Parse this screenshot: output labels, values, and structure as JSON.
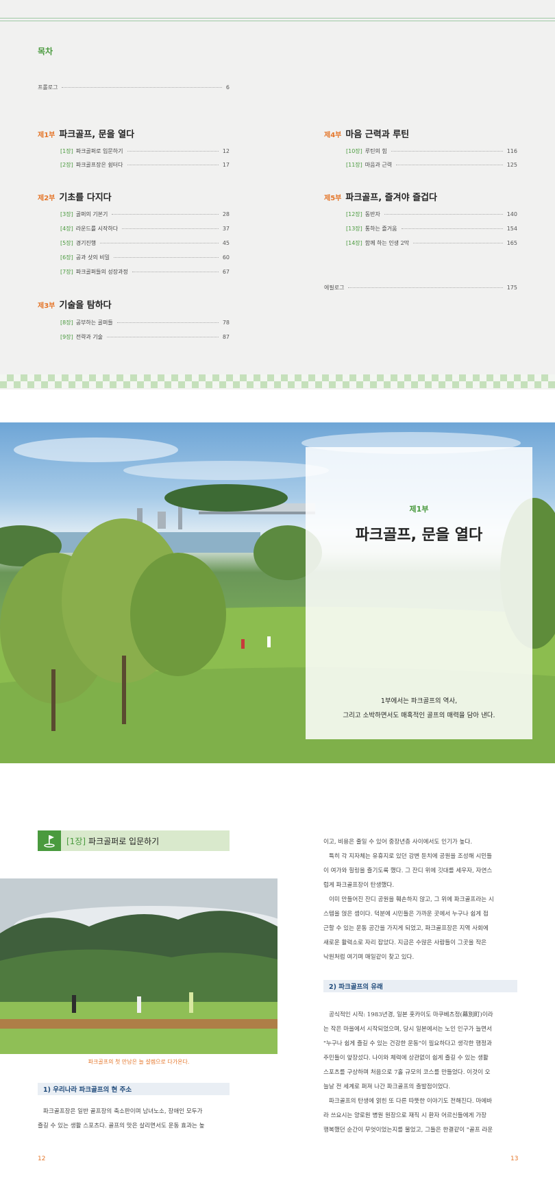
{
  "toc": {
    "heading": "목차",
    "prologue": {
      "label": "프롤로그",
      "page": "6"
    },
    "epilogue": {
      "label": "에필로그",
      "page": "175"
    },
    "parts": [
      {
        "num": "제1부",
        "title": "파크골프, 문을 열다",
        "chapters": [
          {
            "tag": "[1장]",
            "title": "파크골퍼로 입문하기",
            "page": "12"
          },
          {
            "tag": "[2장]",
            "title": "파크골프장은 쉼터다",
            "page": "17"
          }
        ]
      },
      {
        "num": "제2부",
        "title": "기초를 다지다",
        "chapters": [
          {
            "tag": "[3장]",
            "title": "골퍼의 기본기",
            "page": "28"
          },
          {
            "tag": "[4장]",
            "title": "라운드를 시작하다",
            "page": "37"
          },
          {
            "tag": "[5장]",
            "title": "경기진행",
            "page": "45"
          },
          {
            "tag": "[6장]",
            "title": "공과 샷의 비밀",
            "page": "60"
          },
          {
            "tag": "[7장]",
            "title": "파크골퍼들의 성장과정",
            "page": "67"
          }
        ]
      },
      {
        "num": "제3부",
        "title": "기술을 탐하다",
        "chapters": [
          {
            "tag": "[8장]",
            "title": "공부하는 골퍼들",
            "page": "78"
          },
          {
            "tag": "[9장]",
            "title": "전략과 기술",
            "page": "87"
          }
        ]
      },
      {
        "num": "제4부",
        "title": "마음 근력과 루틴",
        "chapters": [
          {
            "tag": "[10장]",
            "title": "루틴의 힘",
            "page": "116"
          },
          {
            "tag": "[11장]",
            "title": "마음과 근력",
            "page": "125"
          }
        ]
      },
      {
        "num": "제5부",
        "title": "파크골프, 즐겨야 즐겁다",
        "chapters": [
          {
            "tag": "[12장]",
            "title": "동반자",
            "page": "140"
          },
          {
            "tag": "[13장]",
            "title": "통하는 즐거움",
            "page": "154"
          },
          {
            "tag": "[14장]",
            "title": "함께 하는 인생 2막",
            "page": "165"
          }
        ]
      }
    ]
  },
  "divider": {
    "part": "제1부",
    "title": "파크골프, 문을 열다",
    "desc_line1": "1부에서는 파크골프의 역사,",
    "desc_line2": "그리고 소박하면서도 매혹적인 골프의 매력을 담아 낸다."
  },
  "chapter": {
    "tag": "[1장]",
    "title": "파크골퍼로 입문하기",
    "caption": "파크골프의 첫 만남은 늘 설렘으로 다가온다.",
    "section1": "1) 우리나라 파크골프의 현 주소",
    "section2": "2) 파크골프의 유래",
    "left_paras": [
      "파크골프장은 일반 골프장의 축소판이며 남녀노소, 장애인 모두가",
      "즐길 수 있는 생활 스포츠다. 골프의 맛은 살리면서도 운동 효과는 높"
    ],
    "right_top": [
      "이고, 비용은 줄일 수 있어 중장년층 사이에서도 인기가 높다.",
      "특히 각 지자체는 유휴지로 있던 강변 둔치에 공원을 조성해 시민들",
      "이 여가와 힐링을 즐기도록 했다. 그 잔디 위에 깃대를 세우자, 자연스",
      "럽게 파크골프장이 탄생했다.",
      "이미 만들어진 잔디 공원을 훼손하지 않고, 그 위에 파크골프라는 시",
      "스템을 얹은 셈이다. 덕분에 시민들은 가까운 곳에서 누구나 쉽게 접",
      "근할 수 있는 운동 공간을 가지게 되었고, 파크골프장은 지역 사회에",
      "새로운 활력소로 자리 잡았다. 지금은 수많은 사람들이 그곳을 작은",
      "낙원처럼 여기며 매일같이 찾고 있다."
    ],
    "right_bottom": [
      "공식적인 시작: 1983년경, 일본 홋카이도 마쿠베츠정(幕別町)이라",
      "는 작은 마을에서 시작되었으며, 당시 일본에서는 노인 인구가 늘면서",
      "\"누구나 쉽게 즐길 수 있는 건강한 운동\"이 필요하다고 생각한 행정과",
      "주민들이 앞장섰다. 나이와 체력에 상관없이 쉽게 즐길 수 있는 생활",
      "스포츠를 구상하며 처음으로 7홀 규모의 코스를 만들었다. 이것이 오",
      "늘날 전 세계로 퍼져 나간 파크골프의 출발점이었다.",
      "파크골프의 탄생에 얽힌 또 다른 따뜻한 이야기도 전해진다. 마에바",
      "라 쓰요시는 양로원 병원 원장으로 재직 시 환자 어르신들에게 가장",
      "행복했던 순간이 무엇이었는지를 물었고, 그들은 한결같이 \"골프 라운"
    ],
    "page_left": "12",
    "page_right": "13"
  }
}
